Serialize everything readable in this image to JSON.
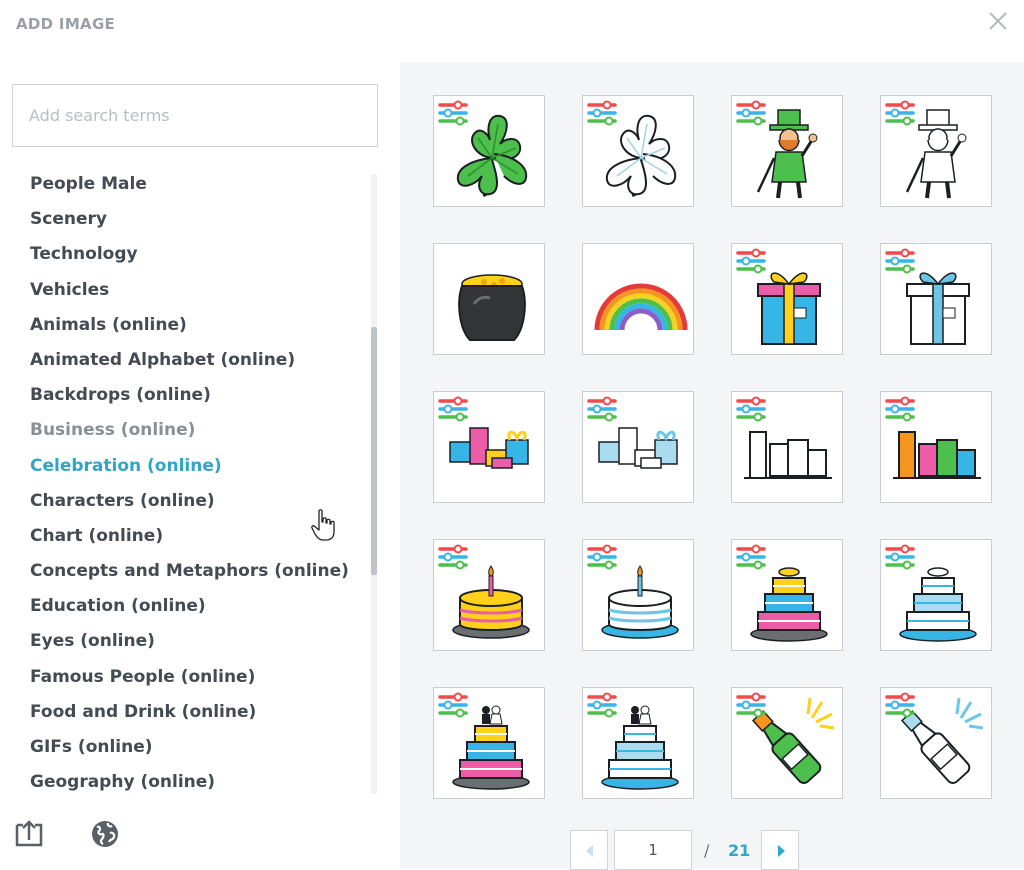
{
  "dialog": {
    "title": "ADD IMAGE"
  },
  "search": {
    "placeholder": "Add search terms",
    "value": ""
  },
  "categories": [
    "People Male",
    "Scenery",
    "Technology",
    "Vehicles",
    "Animals (online)",
    "Animated Alphabet (online)",
    "Backdrops (online)",
    "Business (online)",
    "Celebration (online)",
    "Characters (online)",
    "Chart (online)",
    "Concepts and Metaphors (online)",
    "Education (online)",
    "Eyes (online)",
    "Famous People (online)",
    "Food and Drink (online)",
    "GIFs (online)",
    "Geography (online)"
  ],
  "hovered_category": "Business (online)",
  "selected_category": "Celebration (online)",
  "bottom_icons": [
    "upload-icon",
    "globe-icon"
  ],
  "images": [
    {
      "name": "shamrock-green",
      "variant": "color"
    },
    {
      "name": "shamrock-outline",
      "variant": "outline"
    },
    {
      "name": "leprechaun-color",
      "variant": "color"
    },
    {
      "name": "leprechaun-outline",
      "variant": "outline"
    },
    {
      "name": "pot-of-gold",
      "variant": "color"
    },
    {
      "name": "rainbow",
      "variant": "color"
    },
    {
      "name": "gift-box-color",
      "variant": "color"
    },
    {
      "name": "gift-box-blue",
      "variant": "outline"
    },
    {
      "name": "gift-pile-color",
      "variant": "color"
    },
    {
      "name": "gift-pile-blue",
      "variant": "outline"
    },
    {
      "name": "gift-bags-blue",
      "variant": "outline"
    },
    {
      "name": "gift-bags-color",
      "variant": "color"
    },
    {
      "name": "birthday-cake-color",
      "variant": "color"
    },
    {
      "name": "birthday-cake-blue",
      "variant": "outline"
    },
    {
      "name": "tiered-cake-color",
      "variant": "color"
    },
    {
      "name": "tiered-cake-blue",
      "variant": "outline"
    },
    {
      "name": "wedding-cake-color",
      "variant": "color"
    },
    {
      "name": "wedding-cake-blue",
      "variant": "outline"
    },
    {
      "name": "champagne-bottle-color",
      "variant": "color"
    },
    {
      "name": "champagne-bottle-blue",
      "variant": "outline"
    }
  ],
  "pagination": {
    "current": "1",
    "separator": "/",
    "total": "21"
  },
  "colors": {
    "accent": "#2fa6c8",
    "text": "#454b52",
    "muted": "#8a8f95",
    "panel_bg": "#f4f5f7"
  }
}
